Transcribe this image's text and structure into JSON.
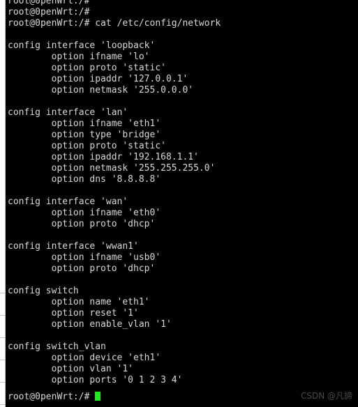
{
  "terminal": {
    "prompt": "root@0penWrt:/#",
    "command": "cat /etc/config/network",
    "cursor_color": "#22e822",
    "text_color": "#d9d9d9",
    "background_color": "#000000",
    "lines": [
      "root@0penWrt:/#",
      "root@0penWrt:/#",
      "root@0penWrt:/# cat /etc/config/network",
      "",
      "config interface 'loopback'",
      "        option ifname 'lo'",
      "        option proto 'static'",
      "        option ipaddr '127.0.0.1'",
      "        option netmask '255.0.0.0'",
      "",
      "config interface 'lan'",
      "        option ifname 'eth1'",
      "        option type 'bridge'",
      "        option proto 'static'",
      "        option ipaddr '192.168.1.1'",
      "        option netmask '255.255.255.0'",
      "        option dns '8.8.8.8'",
      "",
      "config interface 'wan'",
      "        option ifname 'eth0'",
      "        option proto 'dhcp'",
      "",
      "config interface 'wwan1'",
      "        option ifname 'usb0'",
      "        option proto 'dhcp'",
      "",
      "config switch",
      "        option name 'eth1'",
      "        option reset '1'",
      "        option enable_vlan '1'",
      "",
      "config switch_vlan",
      "        option device 'eth1'",
      "        option vlan '1'",
      "        option ports '0 1 2 3 4'",
      ""
    ],
    "final_prompt": "root@0penWrt:/# "
  },
  "gutter": {
    "tick_positions": [
      420,
      452,
      484,
      516,
      548,
      580
    ]
  },
  "watermark": {
    "text": "CSDN @凡諦"
  }
}
